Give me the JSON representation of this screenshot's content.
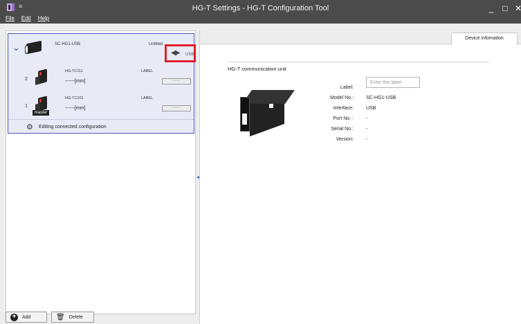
{
  "window": {
    "title": "HG-T Settings - HG-T Configuration Tool",
    "menu_glyph": "≡",
    "min_glyph": "_",
    "max_glyph": "□",
    "close_glyph": "✕"
  },
  "menu": {
    "file": "File",
    "edit": "Edit",
    "help": "Help"
  },
  "tree": {
    "device": {
      "model": "SC-HG1-USB",
      "status": "Untitled",
      "connection_label": "USB",
      "expand_glyph": "⌄",
      "plug_glyph": "◀▶"
    },
    "heads": [
      {
        "index": "2",
        "model": "HG-TC111",
        "value": "------[mm]",
        "label": "LABEL",
        "field": "-------",
        "master": ""
      },
      {
        "index": "1",
        "model": "HG-TC101",
        "value": "------[mm]",
        "label": "LABEL",
        "field": "-------",
        "master": "master"
      }
    ],
    "editing": {
      "text": "Editing connected configuration",
      "gear_glyph": "⚙"
    }
  },
  "collapse_glyph": "◀",
  "buttons": {
    "add": "Add",
    "add_glyph": "+",
    "delete": "Delete",
    "delete_glyph": "🗑"
  },
  "details": {
    "tab": "Device infomation",
    "section": "HG-T communication unit",
    "fields": {
      "label_lbl": "Label:",
      "label_placeholder": "Enter the label",
      "model_lbl": "Model No.:",
      "model_val": "SC-HG1-USB",
      "interface_lbl": "Interface:",
      "interface_val": "USB",
      "port_lbl": "Port No. :",
      "port_val": "-",
      "serial_lbl": "Serial No.:",
      "serial_val": "-",
      "version_lbl": "Version:",
      "version_val": "-"
    }
  }
}
